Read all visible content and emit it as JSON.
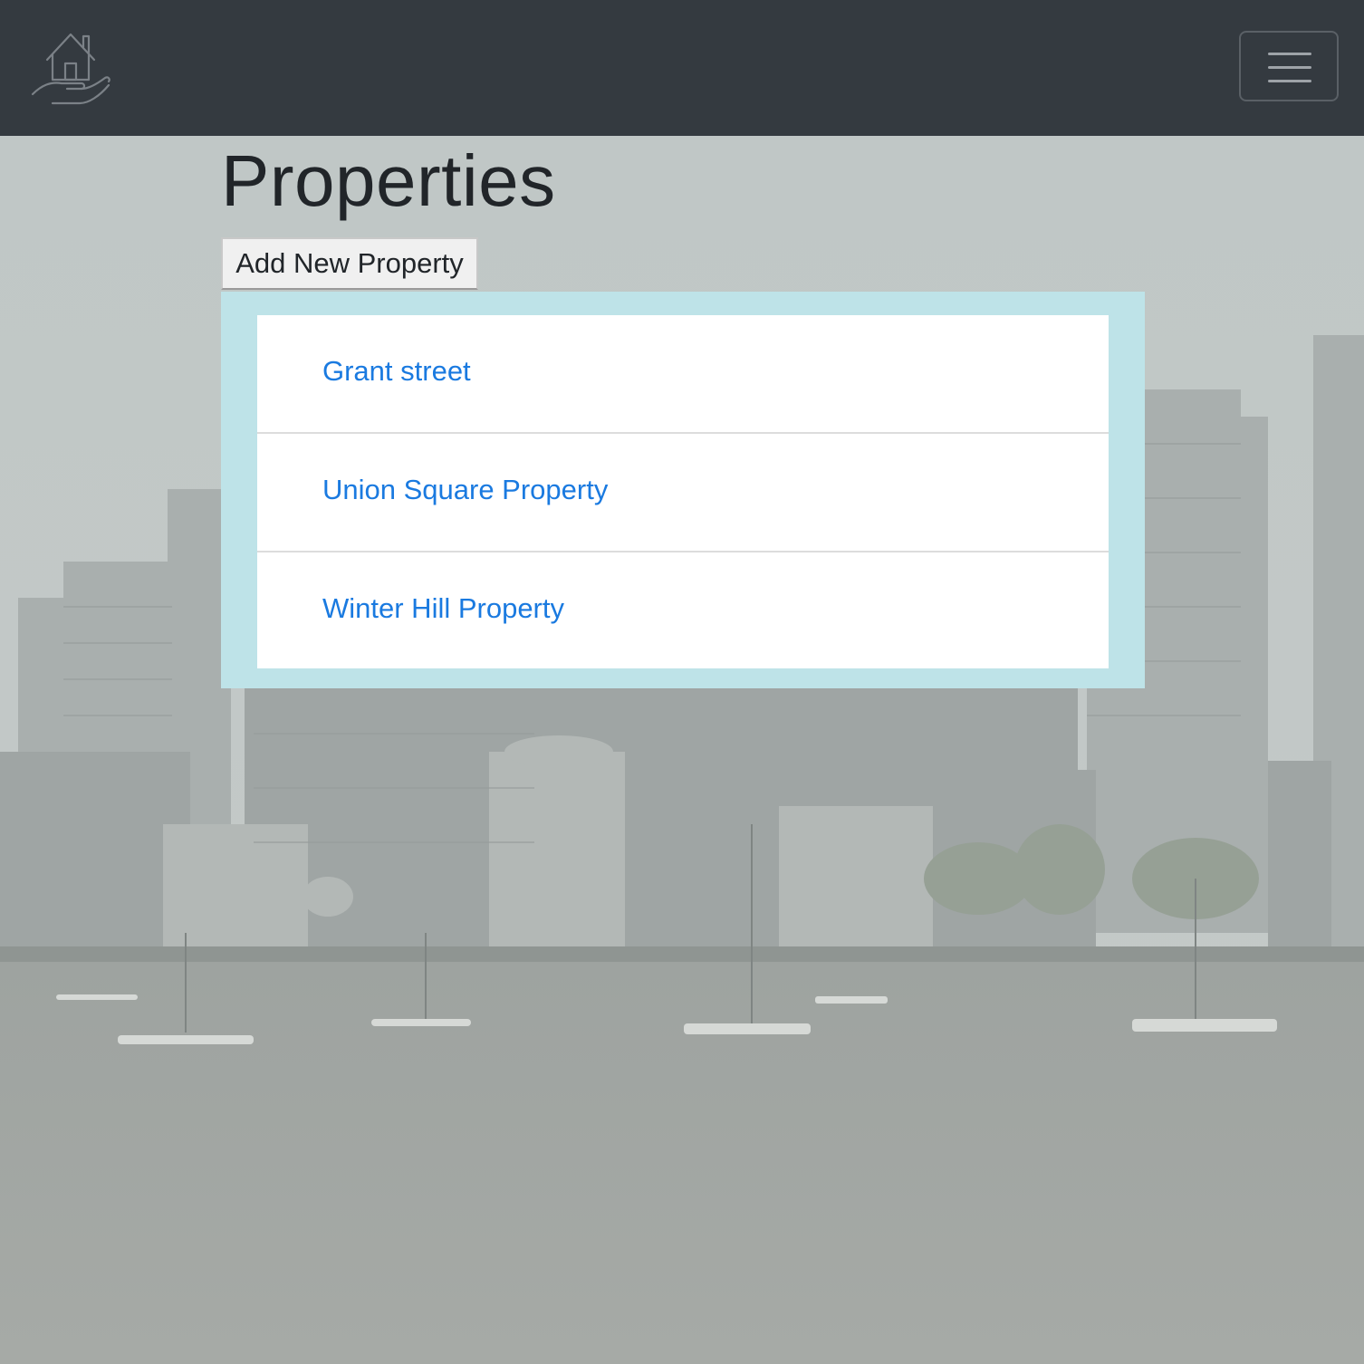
{
  "navbar": {
    "logo_icon": "house-in-hand-icon",
    "toggler_icon": "hamburger-menu-icon"
  },
  "main": {
    "title": "Properties",
    "add_button_label": "Add New Property",
    "properties": [
      {
        "name": "Grant street"
      },
      {
        "name": "Union Square Property"
      },
      {
        "name": "Winter Hill Property"
      }
    ]
  },
  "colors": {
    "navbar_bg": "#343a40",
    "link": "#1a7ae0",
    "panel_bg": "#bee3e8",
    "title_text": "#212529"
  }
}
